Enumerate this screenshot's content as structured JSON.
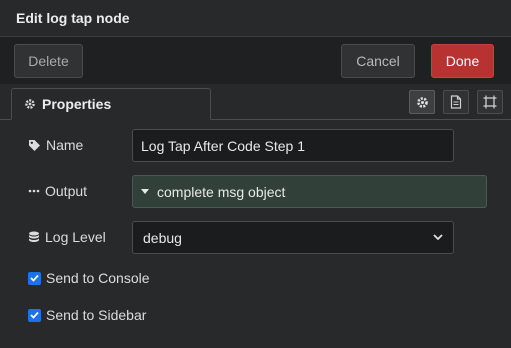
{
  "dialog": {
    "title": "Edit log tap node"
  },
  "buttons": {
    "delete_label": "Delete",
    "cancel_label": "Cancel",
    "done_label": "Done"
  },
  "tabs": {
    "properties_label": "Properties",
    "icon_tabs": [
      "gear-icon",
      "document-icon",
      "frame-icon"
    ]
  },
  "form": {
    "name": {
      "label": "Name",
      "value": "Log Tap After Code Step 1",
      "icon": "tag-icon"
    },
    "output": {
      "label": "Output",
      "value": "complete msg object",
      "icon": "ellipsis-icon"
    },
    "log_level": {
      "label": "Log Level",
      "value": "debug",
      "icon": "database-icon"
    },
    "send_to_console": {
      "label": "Send to Console",
      "checked": true
    },
    "send_to_sidebar": {
      "label": "Send to Sidebar",
      "checked": true
    }
  },
  "colors": {
    "done_button": "#b83232",
    "checkbox": "#1a73e8",
    "background": "#27292b"
  }
}
